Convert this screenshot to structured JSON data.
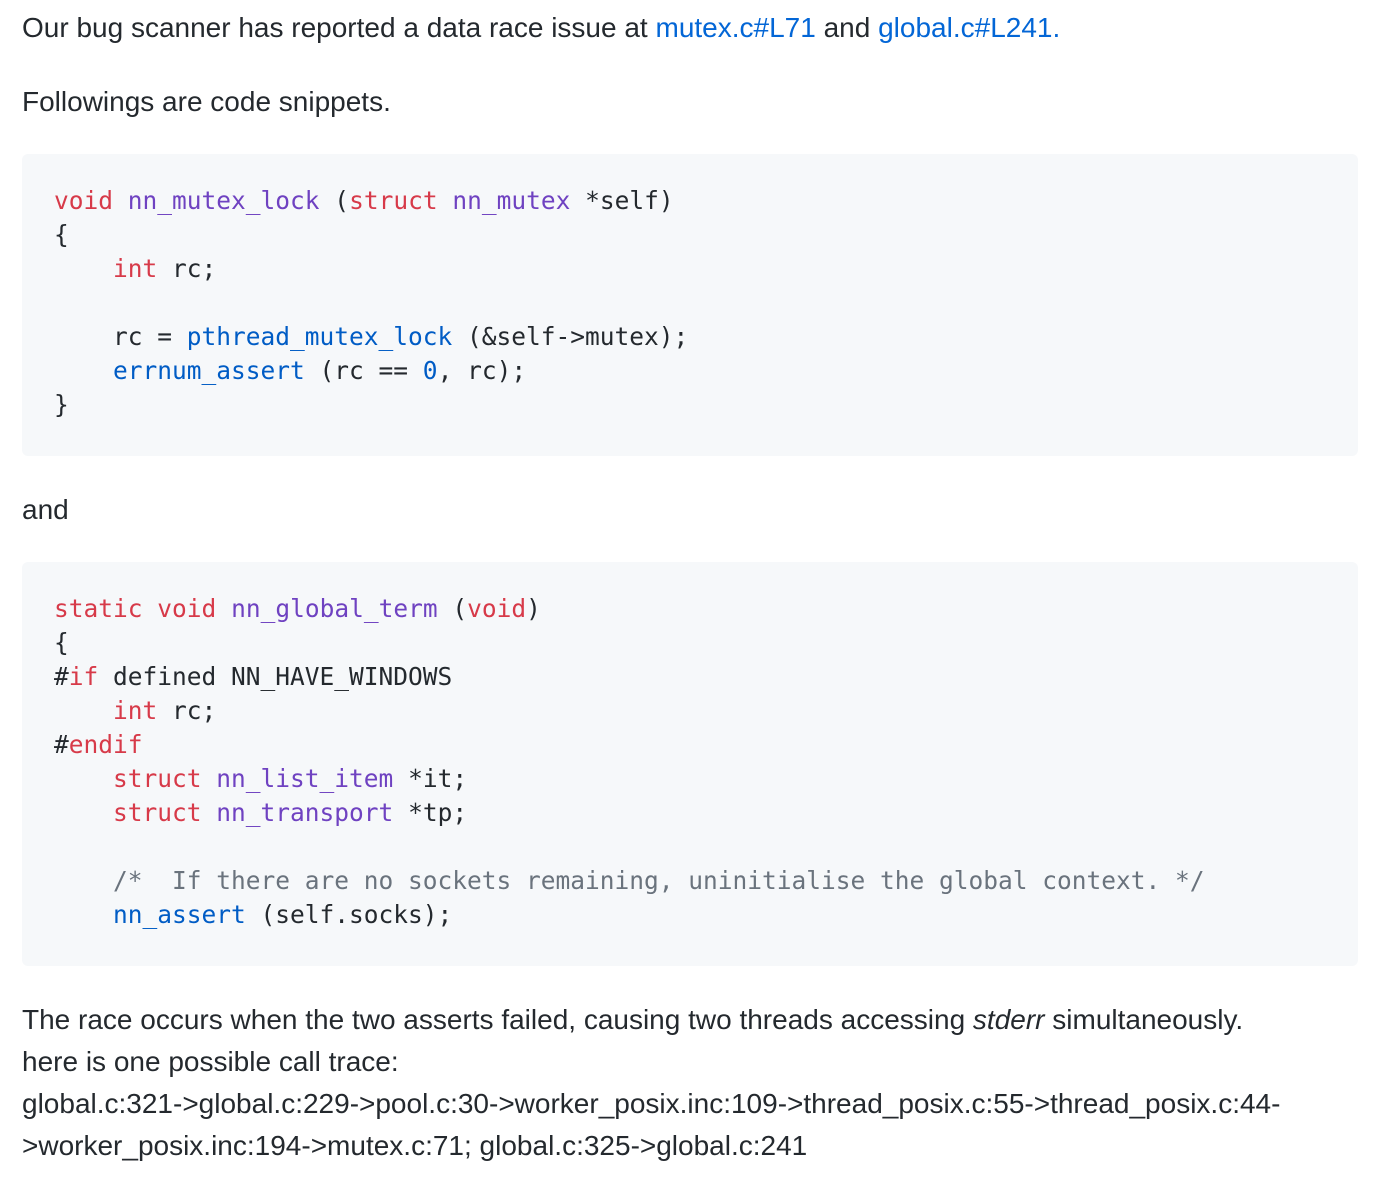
{
  "intro": {
    "text_before": "Our bug scanner has reported a data race issue at ",
    "link1": "mutex.c#L71",
    "text_between": " and ",
    "link2": "global.c#L241",
    "text_after": "."
  },
  "followings": "Followings are code snippets.",
  "code1": {
    "line1": {
      "kw1": "void",
      "sp1": " ",
      "fn": "nn_mutex_lock",
      "sp2": " (",
      "kw2": "struct",
      "sp3": " ",
      "type": "nn_mutex",
      "rest": " *self)"
    },
    "line2": "{",
    "line3": {
      "indent": "    ",
      "kw": "int",
      "rest": " rc;"
    },
    "line4": "",
    "line5": {
      "indent": "    ",
      "pre": "rc = ",
      "bi": "pthread_mutex_lock",
      "rest": " (&self->mutex);"
    },
    "line6": {
      "indent": "    ",
      "bi": "errnum_assert",
      "mid": " (rc == ",
      "num": "0",
      "rest": ", rc);"
    },
    "line7": "}"
  },
  "and_label": "and",
  "code2": {
    "line1": {
      "kw1": "static",
      "sp1": " ",
      "kw2": "void",
      "sp2": " ",
      "fn": "nn_global_term",
      "sp3": " (",
      "kw3": "void",
      "rest": ")"
    },
    "line2": "{",
    "line3": {
      "hash": "#",
      "kw": "if",
      "rest": " defined NN_HAVE_WINDOWS"
    },
    "line4": {
      "indent": "    ",
      "kw": "int",
      "rest": " rc;"
    },
    "line5": {
      "hash": "#",
      "kw": "endif"
    },
    "line6": {
      "indent": "    ",
      "kw": "struct",
      "sp": " ",
      "type": "nn_list_item",
      "rest": " *it;"
    },
    "line7": {
      "indent": "    ",
      "kw": "struct",
      "sp": " ",
      "type": "nn_transport",
      "rest": " *tp;"
    },
    "line8": "",
    "line9": {
      "indent": "    ",
      "comment": "/*  If there are no sockets remaining, uninitialise the global context. */"
    },
    "line10": {
      "indent": "    ",
      "bi": "nn_assert",
      "rest": " (self.socks);"
    }
  },
  "race": {
    "line1_before": "The race occurs when the two asserts failed, causing two threads accessing ",
    "line1_em": "stderr",
    "line1_after": " simultaneously.",
    "line2": "here is one possible call trace:",
    "line3": "global.c:321->global.c:229->pool.c:30->worker_posix.inc:109->thread_posix.c:55->thread_posix.c:44-",
    "line4": ">worker_posix.inc:194->mutex.c:71; global.c:325->global.c:241"
  }
}
